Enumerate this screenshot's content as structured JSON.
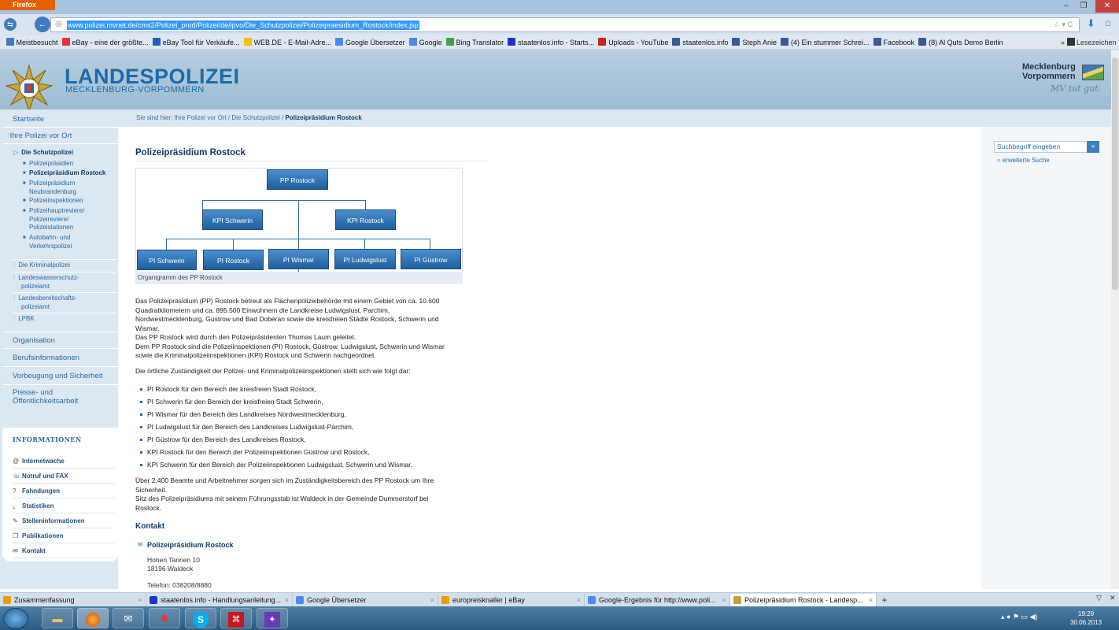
{
  "browser": {
    "menu_label": "Firefox",
    "url": "www.polizei.mvnet.de/cms2/Polizei_prod/Polizei/de/ipvo/Die_Schutzpolizei/Polizeipraesidium_Rostock/index.jsp",
    "bookmarks_overflow": "Lesezeichen"
  },
  "bookmarks": [
    {
      "label": "Meistbesucht",
      "icon": "bookmarks-folder-icon",
      "color": "#3b79c2"
    },
    {
      "label": "eBay - eine der größte...",
      "icon": "ebay-icon",
      "color": "#e53238"
    },
    {
      "label": "eBay Tool für Verkäufe...",
      "icon": "ebay-tool-icon",
      "color": "#1a65b8"
    },
    {
      "label": "WEB.DE - E-Mail-Adre...",
      "icon": "webde-icon",
      "color": "#f0c400"
    },
    {
      "label": "Google Übersetzer",
      "icon": "translate-icon",
      "color": "#4a8ae8"
    },
    {
      "label": "Google",
      "icon": "google-icon",
      "color": "#4a8ae8"
    },
    {
      "label": "Bing Translator",
      "icon": "bing-icon",
      "color": "#3aa54a"
    },
    {
      "label": "staatenlos.info - Starts...",
      "icon": "globe-icon",
      "color": "#1a36c8"
    },
    {
      "label": "Uploads - YouTube",
      "icon": "youtube-icon",
      "color": "#d21f1f"
    },
    {
      "label": "staatenlos.info",
      "icon": "facebook-icon",
      "color": "#3b5998"
    },
    {
      "label": "Steph Anie",
      "icon": "facebook-icon",
      "color": "#3b5998"
    },
    {
      "label": "(4) Ein stummer Schrei...",
      "icon": "facebook-icon",
      "color": "#3b5998"
    },
    {
      "label": "Facebook",
      "icon": "facebook-icon",
      "color": "#3b5998"
    },
    {
      "label": "(8) Al Quts Demo Berlin",
      "icon": "facebook-icon",
      "color": "#3b5998"
    }
  ],
  "header": {
    "logo_title": "LANDESPOLIZEI",
    "logo_subtitle": "MECKLENBURG-VORPOMMERN",
    "mv_line1": "Mecklenburg",
    "mv_line2": "Vorpommern",
    "mv_slogan": "MV tut gut."
  },
  "breadcrumb": {
    "prefix": "Sie sind hier: Ihre Polizei vor Ort / Die Schutzpolizei / ",
    "current": "Polizeipräsidium Rostock"
  },
  "sidebar": {
    "startseite": "Startseite",
    "ihre_polizei": "Ihre Polizei vor Ort",
    "schutzpolizei": "Die Schutzpolizei",
    "sub_items": [
      "Polizeipräsidien",
      "Polizeipräsidium Rostock",
      "Polizeipräsidium",
      "Neubrandenburg",
      "Polizeiinspektionen",
      "Polizeihauptreviere/",
      "Polizeireviere/",
      "Polizeistationen",
      "Autobahn- und",
      "Verkehrspolizei"
    ],
    "kripo": "Die Kriminalpolizei",
    "wasser1": "Landeswasserschutz-",
    "wasser2": "polizeiamt",
    "bereit1": "Landesbereitschafts-",
    "bereit2": "polizeiamt",
    "lpbk": "LPBK",
    "organisation": "Organisation",
    "beruf": "Berufsinformationen",
    "vorbeugung": "Vorbeugung und Sicherheit",
    "presse1": "Presse- und",
    "presse2": "Öffentlichkeitsarbeit",
    "info_title": "INFORMATIONEN",
    "info_items": [
      {
        "label": "Internetwache",
        "icon": "at-icon",
        "glyph": "@"
      },
      {
        "label": "Notruf und FAX",
        "icon": "phone-icon",
        "glyph": "☏"
      },
      {
        "label": "Fahndungen",
        "icon": "question-icon",
        "glyph": "?"
      },
      {
        "label": "Statistiken",
        "icon": "chart-icon",
        "glyph": "⌞"
      },
      {
        "label": "Stelleninformationen",
        "icon": "pen-icon",
        "glyph": "✎"
      },
      {
        "label": "Publikationen",
        "icon": "document-icon",
        "glyph": "❐"
      },
      {
        "label": "Kontakt",
        "icon": "contact-icon",
        "glyph": "✉"
      }
    ]
  },
  "right": {
    "search_placeholder": "Suchbegriff eingeben",
    "search_btn": "»",
    "advanced": "erweiterte Suche"
  },
  "content": {
    "title": "Polizeipräsidium Rostock",
    "org": {
      "top": "PP Rostock",
      "kpi1": "KPI Schwerin",
      "kpi2": "KPI Rostock",
      "pi": [
        "PI Schwerin",
        "PI Rostock",
        "PI Wismar",
        "PI Ludwigslust",
        "PI Güstrow"
      ],
      "caption": "Organigramm des PP Rostock"
    },
    "para1": [
      "Das Polizeipräsidium (PP) Rostock betreut als Flächenpolizeibehörde mit einem Gebiet von ca. 10.600",
      "Quadratkilometern und ca. 895.500 Einwohnern die Landkreise Ludwigslust, Parchim,",
      "Nordwestmecklenburg, Güstrow und Bad Doberan sowie die kreisfreien Städte Rostock, Schwerin und",
      "Wismar.",
      "Das PP Rostock wird durch den Polizeipräsidenten Thomas Laum geleitet.",
      "Dem PP Rostock sind die Polizeiinspektionen (PI) Rostock, Güstrow, Ludwigslust, Schwerin und Wismar",
      "sowie die Kriminalpolizeiinspektionen (KPI) Rostock und Schwerin nachgeordnet."
    ],
    "para2": "Die örtliche Zuständigkeit der Polizei- und Kriminalpolizeiinspektionen stellt sich wie folgt dar:",
    "list": [
      "PI Rostock für den Bereich der kreisfreien Stadt Rostock,",
      "PI Schwerin für den Bereich der kreisfreien Stadt Schwerin,",
      "PI Wismar für den Bereich des Landkreises Nordwestmecklenburg,",
      "PI Ludwigslust für den Bereich des Landkreises Ludwigslust-Parchim,",
      "PI Güstrow für den Bereich des Landkreises Rostock,",
      "KPI Rostock für den Bereich der Polizeiinspektionen Güstrow und Rostock,",
      "KPI Schwerin für den Bereich der Polizeiinspektionen Ludwigslust, Schwerin und Wismar."
    ],
    "para3": [
      "Über 2.400 Beamte und Arbeitnehmer sorgen sich im Zuständigkeitsbereich des PP Rostock um Ihre",
      "Sicherheit.",
      "Sitz des Polizeipräsidiums mit seinem Führungsstab ist Waldeck in der Gemeinde Dummerstorf bei",
      "Rostock."
    ],
    "kontakt_title": "Kontakt",
    "kontakt_name": "Polizeipräsidium Rostock",
    "address1": "Hohen Tannen 10",
    "address2": "18196 Waldeck",
    "phone": "Telefon:  038208/8880"
  },
  "tabs": [
    {
      "label": "Zusammenfassung",
      "icon": "ebay-icon",
      "color": "#e5a000"
    },
    {
      "label": "staatenlos.info - Handlungsanleitung...",
      "icon": "globe-icon",
      "color": "#1a36c8"
    },
    {
      "label": "Google Übersetzer",
      "icon": "translate-icon",
      "color": "#4a8ae8"
    },
    {
      "label": "europreisknaller | eBay",
      "icon": "ebay-icon",
      "color": "#e5a000"
    },
    {
      "label": "Google-Ergebnis für http://www.poli...",
      "icon": "google-icon",
      "color": "#4a8ae8"
    },
    {
      "label": "Polizeipräsidium Rostock - Landesp...",
      "icon": "police-star-icon",
      "color": "#c2a040"
    }
  ],
  "taskbar": {
    "time": "19:29",
    "date": "30.06.2013"
  }
}
